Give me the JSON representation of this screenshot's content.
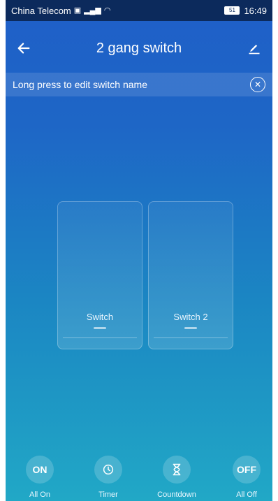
{
  "status_bar": {
    "carrier": "China Telecom",
    "battery_level": "51",
    "time": "16:49"
  },
  "header": {
    "title": "2 gang switch",
    "back_icon": "back-arrow-icon",
    "edit_icon": "edit-pencil-icon"
  },
  "tip": {
    "text": "Long press to edit switch name",
    "close_icon": "close-circle-icon"
  },
  "switches": [
    {
      "label": "Switch"
    },
    {
      "label": "Switch 2"
    }
  ],
  "actions": [
    {
      "icon_text": "ON",
      "label": "All On"
    },
    {
      "icon": "clock-icon",
      "label": "Timer"
    },
    {
      "icon": "hourglass-icon",
      "label": "Countdown"
    },
    {
      "icon_text": "OFF",
      "label": "All Off"
    }
  ],
  "colors": {
    "background_top": "#1f5fc8",
    "background_bottom": "#21a8c6",
    "status_bar": "#0c2a5c"
  }
}
